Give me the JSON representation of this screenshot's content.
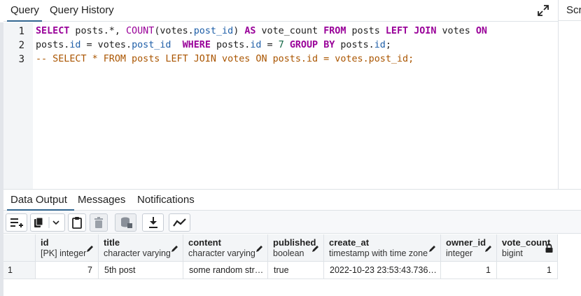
{
  "tabs": {
    "query": "Query",
    "query_history": "Query History",
    "scratch_pad_partial": "Scra"
  },
  "editor": {
    "line_numbers": [
      "1",
      "2",
      "3"
    ],
    "lines": [
      "SELECT posts.*, COUNT(votes.post_id) AS vote_count FROM posts LEFT JOIN votes ON",
      "posts.id = votes.post_id  WHERE posts.id = 7 GROUP BY posts.id;",
      "-- SELECT * FROM posts LEFT JOIN votes ON posts.id = votes.post_id;"
    ]
  },
  "output_tabs": {
    "data_output": "Data Output",
    "messages": "Messages",
    "notifications": "Notifications"
  },
  "toolbar": {
    "icons": [
      "add-row-icon",
      "copy-icon",
      "chevron-down-icon",
      "paste-icon",
      "delete-icon",
      "save-data-icon",
      "download-icon",
      "graph-icon"
    ]
  },
  "grid": {
    "columns": [
      {
        "name": "id",
        "type": "[PK] integer"
      },
      {
        "name": "title",
        "type": "character varying"
      },
      {
        "name": "content",
        "type": "character varying"
      },
      {
        "name": "published",
        "type": "boolean"
      },
      {
        "name": "create_at",
        "type": "timestamp with time zone"
      },
      {
        "name": "owner_id",
        "type": "integer"
      },
      {
        "name": "vote_count",
        "type": "bigint"
      }
    ],
    "rows": [
      {
        "row_no": "1",
        "cells": [
          "7",
          "5th post",
          "some random str…",
          "true",
          "2022-10-23 23:53:43.736…",
          "1",
          "1"
        ]
      }
    ]
  },
  "colors": {
    "keyword": "#990099",
    "property": "#1f5fa8",
    "number": "#116644",
    "comment": "#aa5500",
    "active_tab": "#326690"
  }
}
